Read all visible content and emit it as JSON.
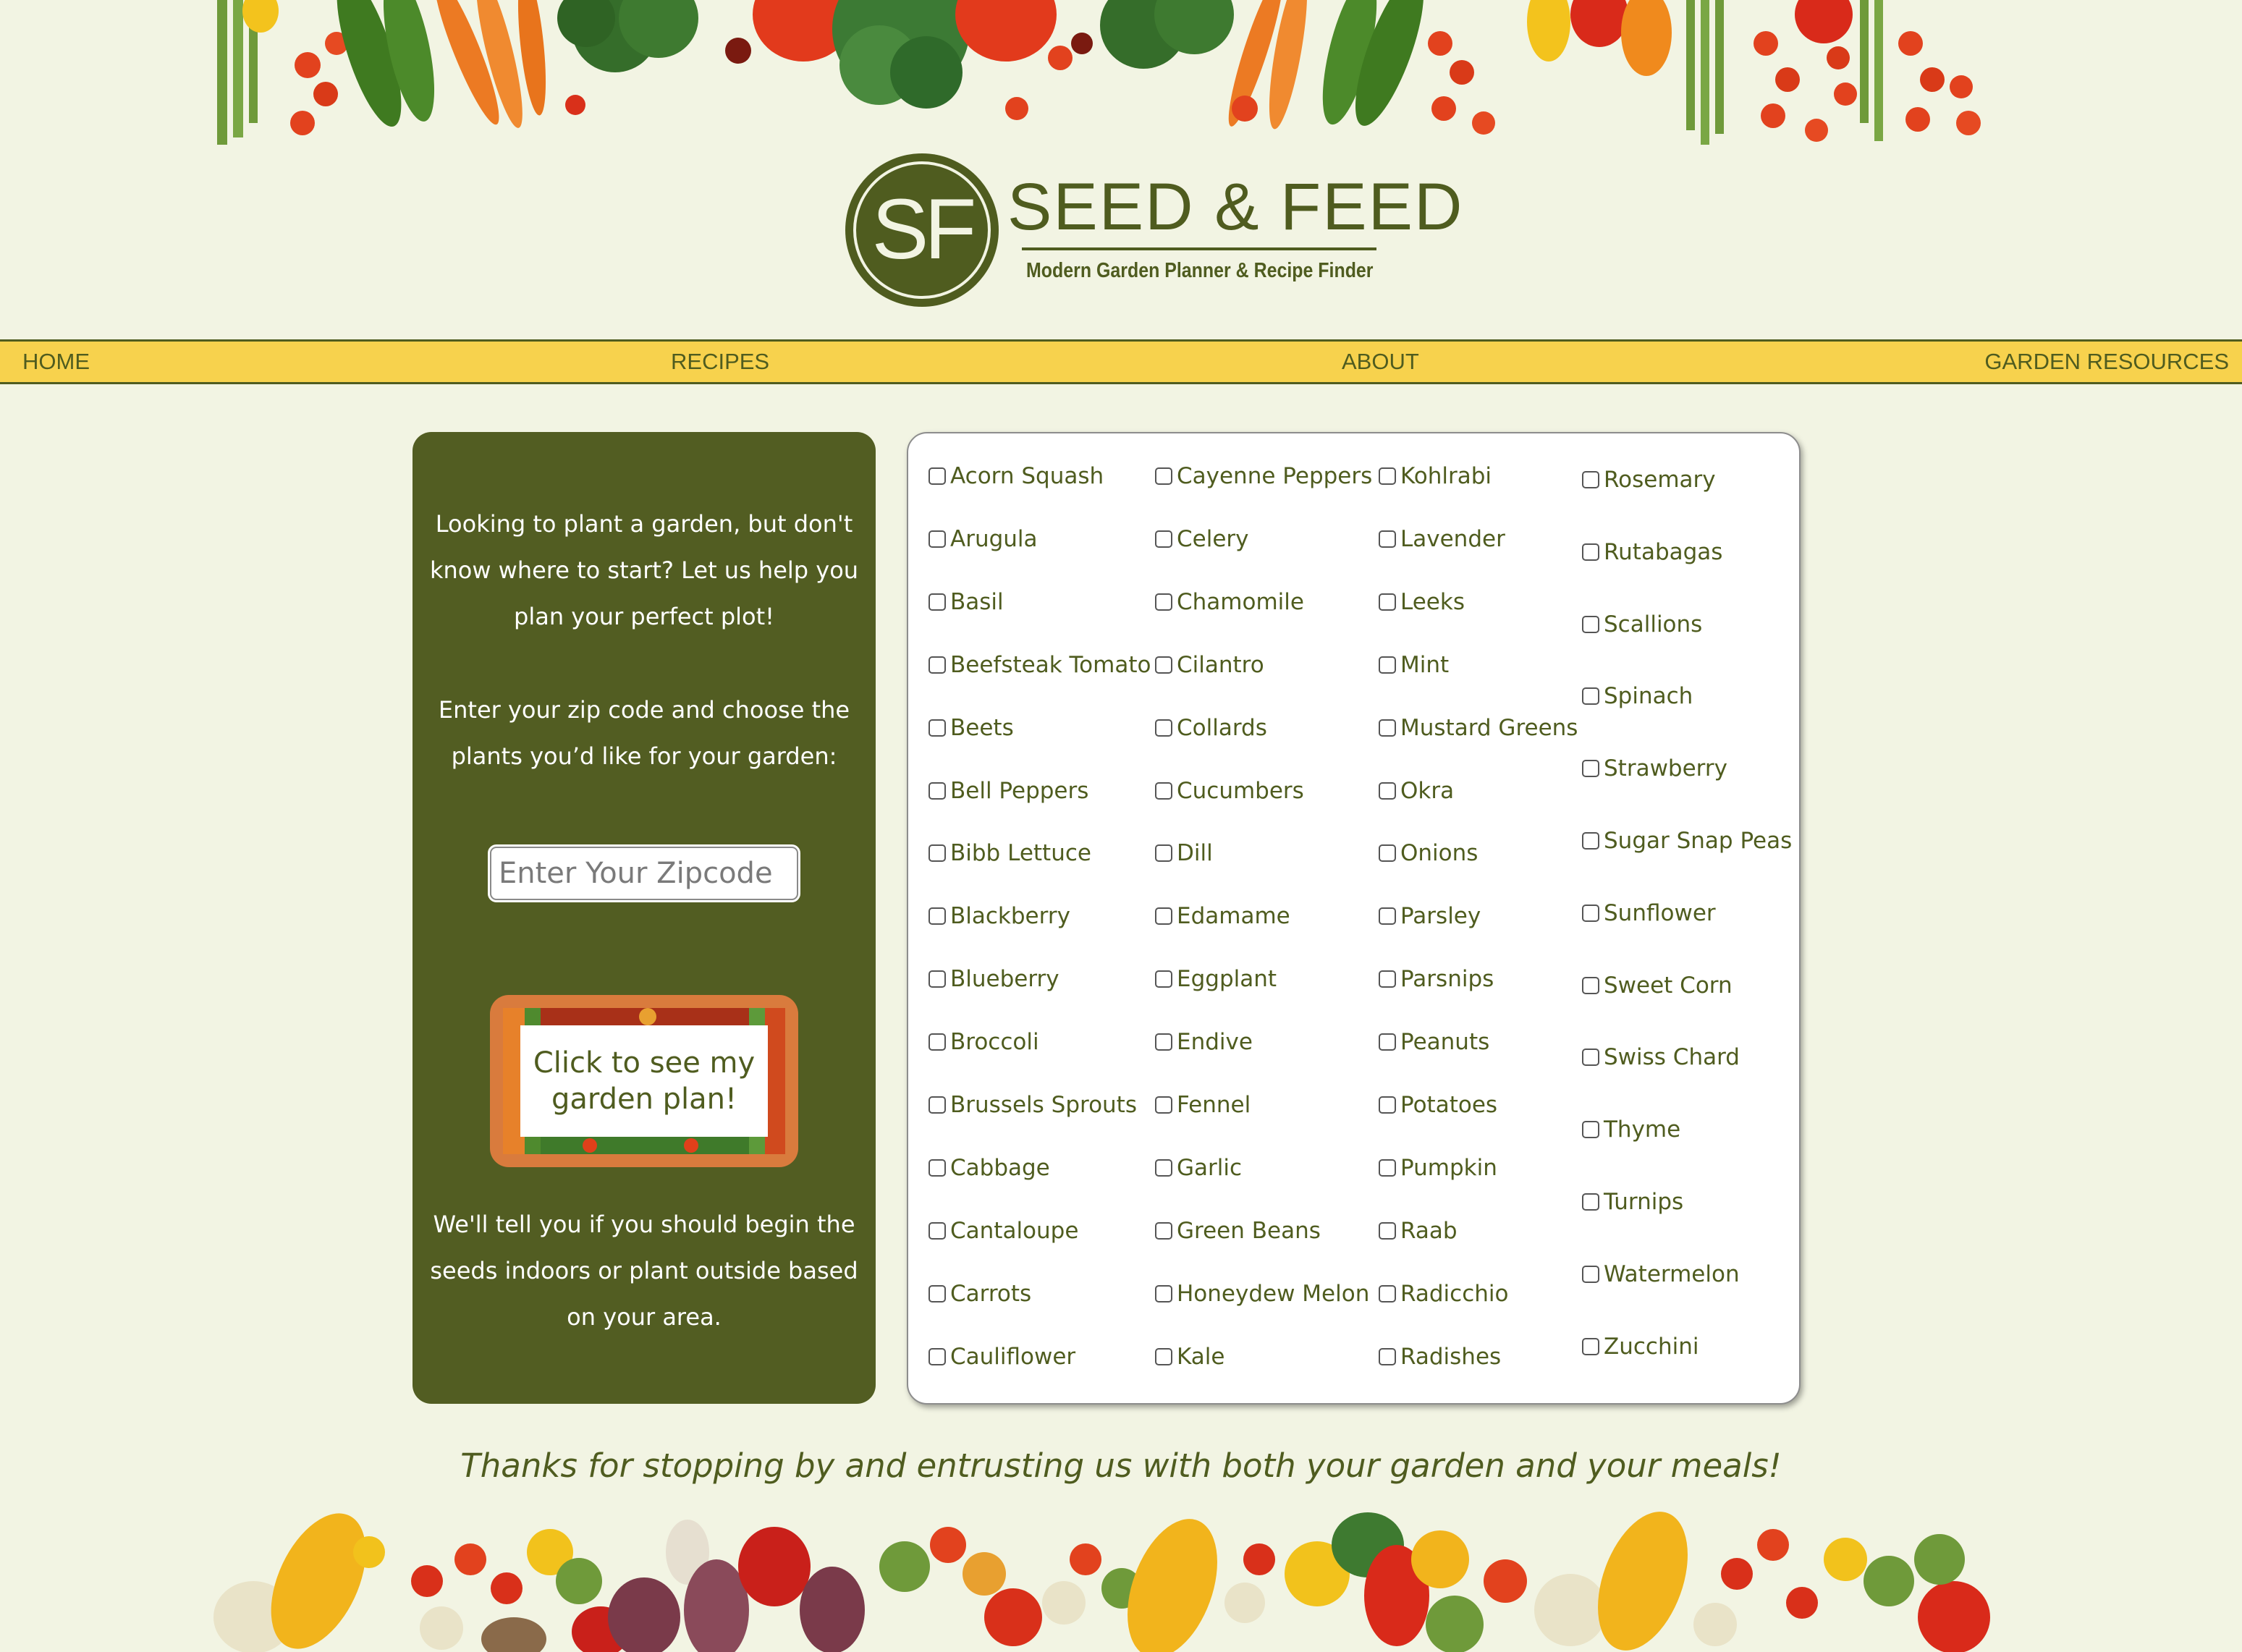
{
  "logo": {
    "monogram": "SF",
    "title": "SEED & FEED",
    "tagline": "Modern Garden Planner & Recipe Finder"
  },
  "nav": {
    "home": "HOME",
    "recipes": "RECIPES",
    "about": "ABOUT",
    "garden_resources": "GARDEN RESOURCES"
  },
  "left_panel": {
    "intro": "Looking to plant a garden, but don't know where to start? Let us help you plan your perfect plot!",
    "instruction": "Enter your zip code and choose the plants you’d like for your garden:",
    "zip_placeholder": "Enter Your Zipcode",
    "button_label": "Click to see my garden plan!",
    "outro": "We'll tell you if you should begin the seeds indoors or plant outside based on your area."
  },
  "plants": [
    [
      "Acorn Squash",
      "Arugula",
      "Basil",
      "Beefsteak Tomato",
      "Beets",
      "Bell Peppers",
      "Bibb Lettuce",
      "Blackberry",
      "Blueberry",
      "Broccoli",
      "Brussels Sprouts",
      "Cabbage",
      "Cantaloupe",
      "Carrots",
      "Cauliflower"
    ],
    [
      "Cayenne Peppers",
      "Celery",
      "Chamomile",
      "Cilantro",
      "Collards",
      "Cucumbers",
      "Dill",
      "Edamame",
      "Eggplant",
      "Endive",
      "Fennel",
      "Garlic",
      "Green Beans",
      "Honeydew Melon",
      "Kale"
    ],
    [
      "Kohlrabi",
      "Lavender",
      "Leeks",
      "Mint",
      "Mustard Greens",
      "Okra",
      "Onions",
      "Parsley",
      "Parsnips",
      "Peanuts",
      "Potatoes",
      "Pumpkin",
      "Raab",
      "Radicchio",
      "Radishes"
    ],
    [
      "Rosemary",
      "Rutabagas",
      "Scallions",
      "Spinach",
      "Strawberry",
      "Sugar Snap Peas",
      "Sunflower",
      "Sweet Corn",
      "Swiss Chard",
      "Thyme",
      "Turnips",
      "Watermelon",
      "Zucchini"
    ]
  ],
  "footer": {
    "thanks": "Thanks for stopping by and entrusting us with both your garden and your meals!"
  },
  "colors": {
    "background": "#f2f4e3",
    "brand_green": "#4f5c1f",
    "nav_yellow": "#f7d24d",
    "button_orange": "#d97b3d"
  }
}
